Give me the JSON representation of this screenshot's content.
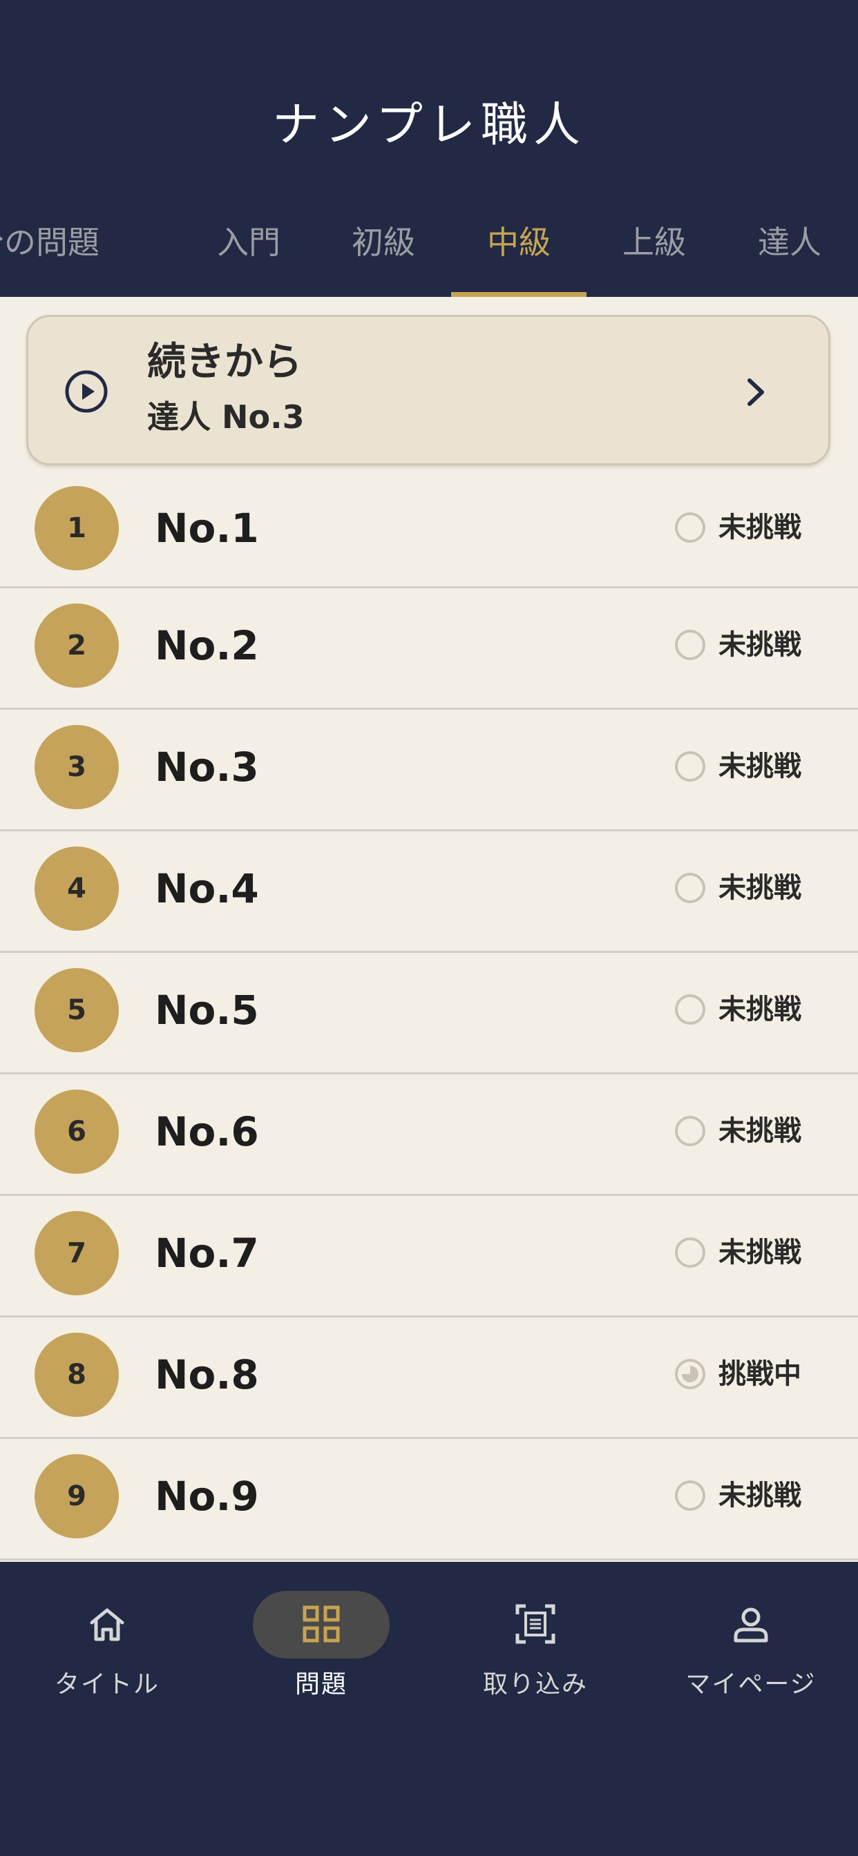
{
  "header": {
    "title": "ナンプレ職人",
    "tabs": [
      {
        "label": "自分の問題",
        "active": false
      },
      {
        "label": "入門",
        "active": false
      },
      {
        "label": "初級",
        "active": false
      },
      {
        "label": "中級",
        "active": true
      },
      {
        "label": "上級",
        "active": false
      },
      {
        "label": "達人",
        "active": false
      }
    ]
  },
  "continue_card": {
    "icon": "play-circle-icon",
    "title": "続きから",
    "subtitle": "達人 No.3",
    "chevron": "chevron-right-icon"
  },
  "problems": [
    {
      "number": "1",
      "label": "No.1",
      "status": "未挑戦",
      "status_icon": "empty-circle-icon"
    },
    {
      "number": "2",
      "label": "No.2",
      "status": "未挑戦",
      "status_icon": "empty-circle-icon"
    },
    {
      "number": "3",
      "label": "No.3",
      "status": "未挑戦",
      "status_icon": "empty-circle-icon"
    },
    {
      "number": "4",
      "label": "No.4",
      "status": "未挑戦",
      "status_icon": "empty-circle-icon"
    },
    {
      "number": "5",
      "label": "No.5",
      "status": "未挑戦",
      "status_icon": "empty-circle-icon"
    },
    {
      "number": "6",
      "label": "No.6",
      "status": "未挑戦",
      "status_icon": "empty-circle-icon"
    },
    {
      "number": "7",
      "label": "No.7",
      "status": "未挑戦",
      "status_icon": "empty-circle-icon"
    },
    {
      "number": "8",
      "label": "No.8",
      "status": "挑戦中",
      "status_icon": "partial-circle-icon"
    },
    {
      "number": "9",
      "label": "No.9",
      "status": "未挑戦",
      "status_icon": "empty-circle-icon"
    }
  ],
  "bottom_nav": [
    {
      "label": "タイトル",
      "icon": "home-icon",
      "active": false
    },
    {
      "label": "問題",
      "icon": "grid-icon",
      "active": true
    },
    {
      "label": "取り込み",
      "icon": "scan-icon",
      "active": false
    },
    {
      "label": "マイページ",
      "icon": "person-icon",
      "active": false
    }
  ],
  "colors": {
    "navy": "#212944",
    "gold": "#c8a452",
    "cream": "#f4efe4",
    "card": "#ebe3d1"
  }
}
